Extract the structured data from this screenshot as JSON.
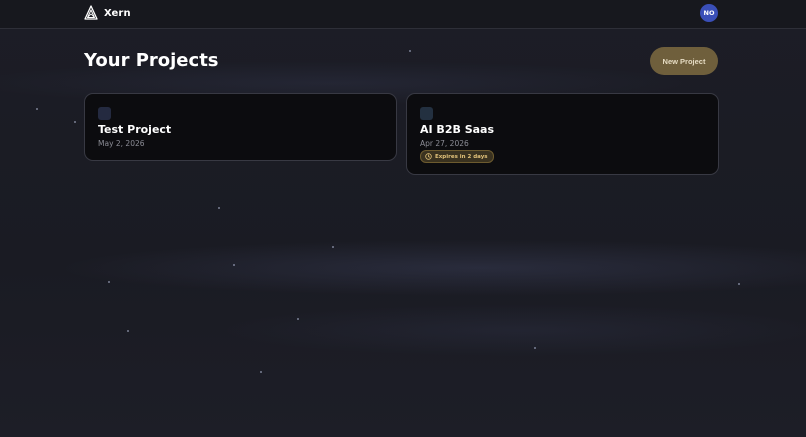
{
  "app": {
    "name": "Xern",
    "logo_icon": "triangle-logo-icon"
  },
  "user": {
    "initials": "NO",
    "avatar_color": "#3a4fb8"
  },
  "page": {
    "title": "Your Projects",
    "new_project_label": "New Project"
  },
  "projects": [
    {
      "name": "Test Project",
      "date": "May 2, 2026",
      "icon_color": "#242a40"
    },
    {
      "name": "AI B2B Saas",
      "date": "Apr 27, 2026",
      "icon_color": "#233040",
      "badge": {
        "text": "Expires in 2 days",
        "icon": "clock-icon",
        "color": "#e2c27a"
      }
    }
  ],
  "colors": {
    "accent_button": "#6f5f3c",
    "background": "#1b1c25",
    "card_background": "#0c0c0f"
  }
}
